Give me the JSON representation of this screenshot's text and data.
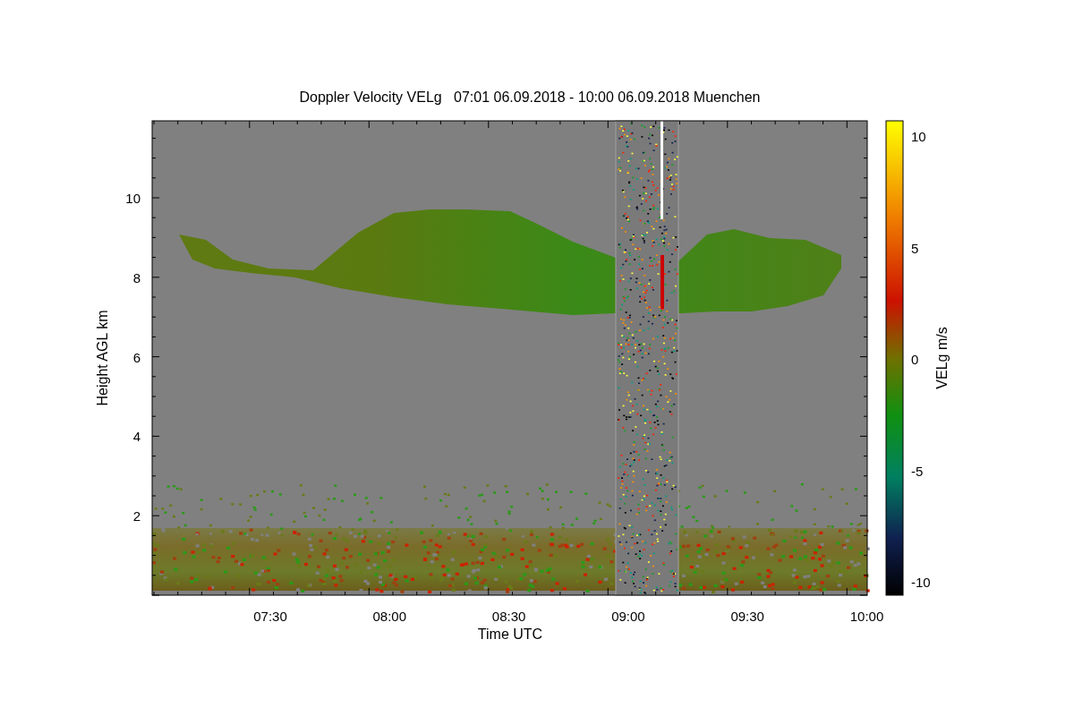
{
  "title": "Doppler Velocity VELg   07:01 06.09.2018 - 10:00 06.09.2018 Muenchen",
  "y_axis": {
    "label": "Height AGL km",
    "ticks": [
      "10",
      "8",
      "6",
      "4",
      "2"
    ]
  },
  "x_axis": {
    "label": "Time UTC",
    "ticks": [
      "07:30",
      "08:00",
      "08:30",
      "09:00",
      "09:30",
      "10:00"
    ]
  },
  "colorbar": {
    "label": "VELg m/s",
    "ticks": [
      "10",
      "5",
      "0",
      "-5",
      "-10"
    ]
  }
}
